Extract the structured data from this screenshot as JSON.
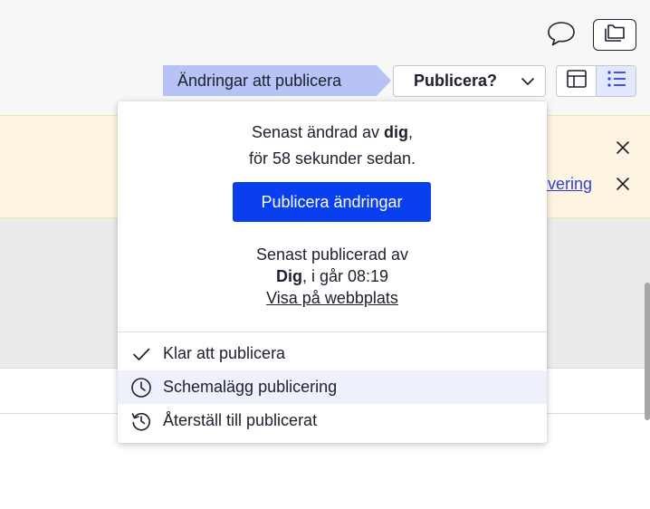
{
  "toolbar": {
    "status_label": "Ändringar att publicera",
    "publish_dropdown_label": "Publicera?",
    "icons": [
      "comment-icon",
      "folder-copy-icon",
      "layout-icon",
      "list-icon"
    ]
  },
  "notice": {
    "link_fragment": "ivering"
  },
  "publish_popover": {
    "modified_line1_prefix": "Senast ändrad av ",
    "modified_user": "dig",
    "modified_line1_suffix": ",",
    "modified_line2": "för 58 sekunder sedan.",
    "publish_button": "Publicera ändringar",
    "published_line1": "Senast publicerad av",
    "published_user": "Dig",
    "published_time": ", i går 08:19",
    "view_on_site_link": "Visa på webbplats",
    "menu_items": [
      {
        "label": "Klar att publicera",
        "icon": "check-icon"
      },
      {
        "label": "Schemalägg publicering",
        "icon": "clock-icon"
      },
      {
        "label": "Återställ till publicerat",
        "icon": "history-icon"
      }
    ]
  },
  "colors": {
    "primary_button": "#0a3ff0",
    "status_chip": "#b7c3f5",
    "notice_bg": "#fdf5e1",
    "menu_highlight": "#eef0fc",
    "link": "#2f3fd8"
  }
}
